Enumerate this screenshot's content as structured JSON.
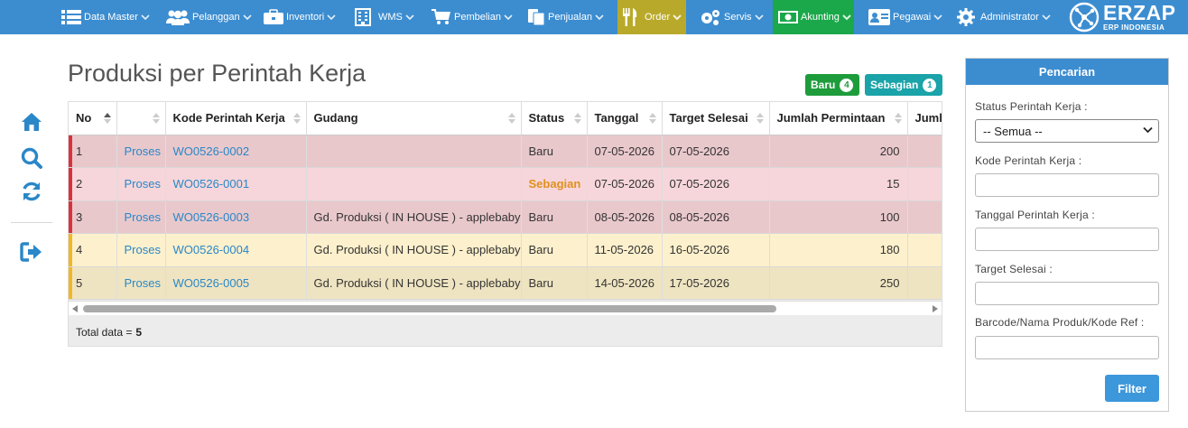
{
  "nav": {
    "items": [
      {
        "label": "Data Master",
        "icon": "list-icon"
      },
      {
        "label": "Pelanggan",
        "icon": "users-icon"
      },
      {
        "label": "Inventori",
        "icon": "briefcase-icon"
      },
      {
        "label": "WMS",
        "icon": "building-icon"
      },
      {
        "label": "Pembelian",
        "icon": "cart-icon"
      },
      {
        "label": "Penjualan",
        "icon": "document-icon"
      },
      {
        "label": "Order",
        "icon": "utensils-icon",
        "active_color": "#b9a92a"
      },
      {
        "label": "Servis",
        "icon": "gears-icon"
      },
      {
        "label": "Akunting",
        "icon": "money-icon",
        "active_color": "#1aa84a"
      },
      {
        "label": "Pegawai",
        "icon": "id-card-icon"
      },
      {
        "label": "Administrator",
        "icon": "gear-icon"
      }
    ],
    "logo": {
      "main": "ERZAP",
      "sub": "ERP INDONESIA"
    },
    "bar_color": "#3c8dd0"
  },
  "sidebar": {
    "icons": [
      "home-icon",
      "search-icon",
      "refresh-icon",
      "logout-icon"
    ],
    "icon_color": "#2a87c8"
  },
  "page": {
    "title": "Produksi per Perintah Kerja"
  },
  "badges": [
    {
      "label": "Baru",
      "count": "4",
      "color": "#1e9c3c"
    },
    {
      "label": "Sebagian",
      "count": "1",
      "color": "#1aa3a8"
    }
  ],
  "table": {
    "columns": [
      "No",
      "",
      "Kode Perintah Kerja",
      "Gudang",
      "Status",
      "Tanggal",
      "Target Selesai",
      "Jumlah Permintaan",
      "Jumlah"
    ],
    "rows": [
      {
        "no": "1",
        "action": "Proses",
        "kode": "WO0526-0002",
        "gudang": "",
        "status": "Baru",
        "tanggal": "07-05-2026",
        "target": "07-05-2026",
        "jumlah": "200",
        "row_color": "#e9c8cc"
      },
      {
        "no": "2",
        "action": "Proses",
        "kode": "WO0526-0001",
        "gudang": "",
        "status": "Sebagian",
        "tanggal": "07-05-2026",
        "target": "07-05-2026",
        "jumlah": "15",
        "row_color": "#f6d6da"
      },
      {
        "no": "3",
        "action": "Proses",
        "kode": "WO0526-0003",
        "gudang": "Gd. Produksi ( IN HOUSE ) - applebaby",
        "status": "Baru",
        "tanggal": "08-05-2026",
        "target": "08-05-2026",
        "jumlah": "100",
        "row_color": "#e9c8cc"
      },
      {
        "no": "4",
        "action": "Proses",
        "kode": "WO0526-0004",
        "gudang": "Gd. Produksi ( IN HOUSE ) - applebaby",
        "status": "Baru",
        "tanggal": "11-05-2026",
        "target": "16-05-2026",
        "jumlah": "180",
        "row_color": "#fdf0cc"
      },
      {
        "no": "5",
        "action": "Proses",
        "kode": "WO0526-0005",
        "gudang": "Gd. Produksi ( IN HOUSE ) - applebaby",
        "status": "Baru",
        "tanggal": "14-05-2026",
        "target": "17-05-2026",
        "jumlah": "250",
        "row_color": "#efe4c1"
      }
    ],
    "total_label": "Total data =",
    "total_value": "5"
  },
  "search": {
    "title": "Pencarian",
    "status_label": "Status Perintah Kerja :",
    "status_value": "-- Semua --",
    "kode_label": "Kode Perintah Kerja :",
    "tanggal_label": "Tanggal Perintah Kerja :",
    "target_label": "Target Selesai :",
    "barcode_label": "Barcode/Nama Produk/Kode Ref :",
    "filter_label": "Filter"
  }
}
